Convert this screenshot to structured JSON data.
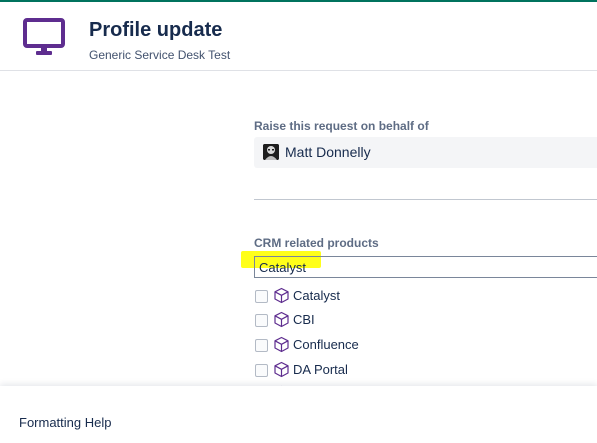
{
  "colors": {
    "top_accent": "#00735e",
    "brand_icon": "#5e2d8f",
    "highlight": "#ffff1a"
  },
  "header": {
    "icon": "monitor-icon",
    "title": "Profile update",
    "subtitle": "Generic Service Desk Test"
  },
  "behalf": {
    "label": "Raise this request on behalf of",
    "user_name": "Matt Donnelly"
  },
  "crm": {
    "label": "CRM related products",
    "search_value": "Catalyst",
    "option_icon": "cube-icon",
    "options": [
      {
        "label": "Catalyst",
        "checked": false
      },
      {
        "label": "CBI",
        "checked": false
      },
      {
        "label": "Confluence",
        "checked": false
      },
      {
        "label": "DA Portal",
        "checked": false
      }
    ]
  },
  "footer": {
    "help_link": "Formatting Help"
  }
}
